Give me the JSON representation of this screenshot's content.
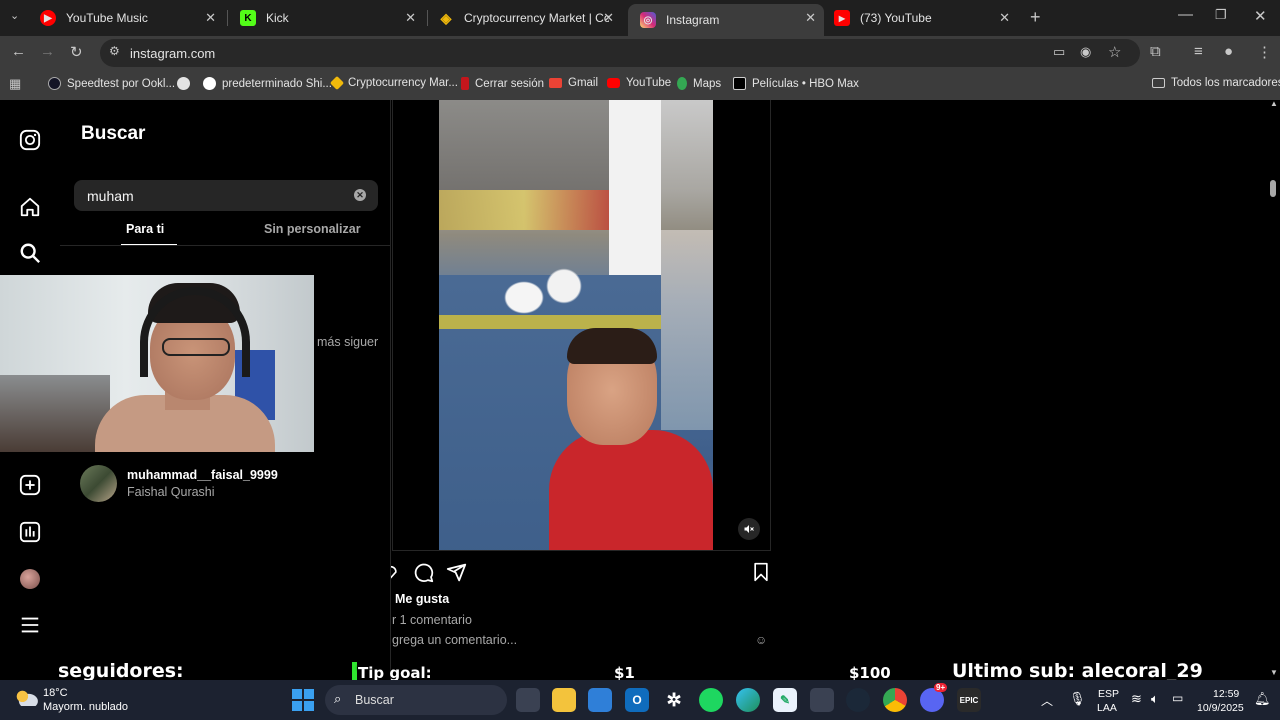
{
  "tabs": [
    {
      "title": "YouTube Music",
      "icon": "youtube-music-icon"
    },
    {
      "title": "Kick",
      "icon": "kick-icon"
    },
    {
      "title": "Cryptocurrency Market | Coin P",
      "icon": "binance-icon"
    },
    {
      "title": "Instagram",
      "icon": "instagram-icon",
      "active": true
    },
    {
      "title": "(73) YouTube",
      "icon": "youtube-icon"
    }
  ],
  "toolbar": {
    "url": "instagram.com"
  },
  "bookmarks": [
    {
      "label": "Speedtest por Ookl...",
      "color": "#141526"
    },
    {
      "label": "",
      "color": "#e3e3e3"
    },
    {
      "label": "predeterminado Shi...",
      "color": "#ffffff"
    },
    {
      "label": "Cryptocurrency Mar...",
      "color": "#f0b90b"
    },
    {
      "label": "Cerrar sesión",
      "color": "#c4161c"
    },
    {
      "label": "Gmail",
      "color": "#ea4335"
    },
    {
      "label": "YouTube",
      "color": "#ff0000"
    },
    {
      "label": "Maps",
      "color": "#34a853"
    },
    {
      "label": "Películas • HBO Max",
      "color": "#000000"
    }
  ],
  "all_bookmarks": "Todos los marcadores",
  "search": {
    "title": "Buscar",
    "value": "muham",
    "tab_for_you": "Para ti",
    "tab_unpersonalized": "Sin personalizar",
    "results": [
      {
        "username": "muhammad__faisal_9999",
        "name": "Faishal Qurashi"
      }
    ],
    "partial_result_text": "más siguer"
  },
  "post": {
    "likes": "Me gusta",
    "comments": "r 1 comentario",
    "add_comment": "grega un comentario..."
  },
  "overlay": {
    "followers": "seguidores:",
    "tip_goal": "Tip goal:",
    "tip_min": "$1",
    "tip_max": "$100",
    "last_sub": "Ultimo sub: alecoral_29"
  },
  "taskbar": {
    "weather_temp": "18°C",
    "weather_desc": "Mayorm. nublado",
    "search_label": "Buscar",
    "lang1": "ESP",
    "lang2": "LAA",
    "time": "12:59",
    "date": "10/9/2025",
    "discord_badge": "9+"
  },
  "colors": {
    "instagram_bg": "#000000",
    "tab_active": "#3c3c3c",
    "taskbar": "#1c2230"
  }
}
